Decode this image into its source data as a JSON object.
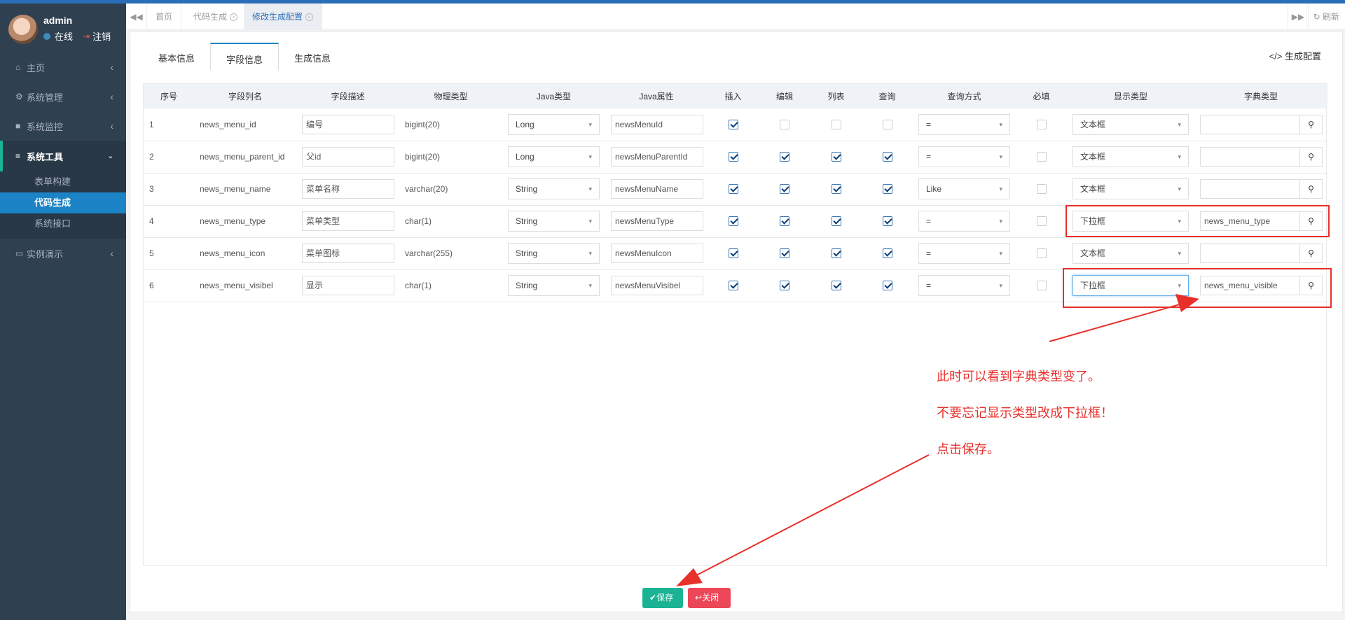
{
  "user": {
    "name": "admin",
    "status": "在线",
    "logout": "注销"
  },
  "sidebar": {
    "items": [
      {
        "label": "主页",
        "icon": "home-icon"
      },
      {
        "label": "系统管理",
        "icon": "gear-icon"
      },
      {
        "label": "系统监控",
        "icon": "video-icon"
      },
      {
        "label": "系统工具",
        "icon": "bars-icon"
      },
      {
        "label": "实例演示",
        "icon": "desktop-icon"
      }
    ],
    "submenu": [
      "表单构建",
      "代码生成",
      "系统接口"
    ]
  },
  "tabs": {
    "items": [
      "首页",
      "代码生成",
      "修改生成配置"
    ],
    "refresh": "刷新"
  },
  "inner_tabs": [
    "基本信息",
    "字段信息",
    "生成信息"
  ],
  "gen_config_link": "生成配置",
  "table": {
    "headers": [
      "序号",
      "字段列名",
      "字段描述",
      "物理类型",
      "Java类型",
      "Java属性",
      "插入",
      "编辑",
      "列表",
      "查询",
      "查询方式",
      "必填",
      "显示类型",
      "字典类型"
    ],
    "rows": [
      {
        "no": "1",
        "column": "news_menu_id",
        "desc": "编号",
        "phys": "bigint(20)",
        "jtype": "Long",
        "jattr": "newsMenuId",
        "insert": true,
        "edit": false,
        "list": false,
        "query": false,
        "qmode": "=",
        "required": false,
        "display": "文本框",
        "dict": ""
      },
      {
        "no": "2",
        "column": "news_menu_parent_id",
        "desc": "父id",
        "phys": "bigint(20)",
        "jtype": "Long",
        "jattr": "newsMenuParentId",
        "insert": true,
        "edit": true,
        "list": true,
        "query": true,
        "qmode": "=",
        "required": false,
        "display": "文本框",
        "dict": ""
      },
      {
        "no": "3",
        "column": "news_menu_name",
        "desc": "菜单名称",
        "phys": "varchar(20)",
        "jtype": "String",
        "jattr": "newsMenuName",
        "insert": true,
        "edit": true,
        "list": true,
        "query": true,
        "qmode": "Like",
        "required": false,
        "display": "文本框",
        "dict": ""
      },
      {
        "no": "4",
        "column": "news_menu_type",
        "desc": "菜单类型",
        "phys": "char(1)",
        "jtype": "String",
        "jattr": "newsMenuType",
        "insert": true,
        "edit": true,
        "list": true,
        "query": true,
        "qmode": "=",
        "required": false,
        "display": "下拉框",
        "dict": "news_menu_type"
      },
      {
        "no": "5",
        "column": "news_menu_icon",
        "desc": "菜单图标",
        "phys": "varchar(255)",
        "jtype": "String",
        "jattr": "newsMenuIcon",
        "insert": true,
        "edit": true,
        "list": true,
        "query": true,
        "qmode": "=",
        "required": false,
        "display": "文本框",
        "dict": ""
      },
      {
        "no": "6",
        "column": "news_menu_visibel",
        "desc": "显示",
        "phys": "char(1)",
        "jtype": "String",
        "jattr": "newsMenuVisibel",
        "insert": true,
        "edit": true,
        "list": true,
        "query": true,
        "qmode": "=",
        "required": false,
        "display": "下拉框",
        "dict": "news_menu_visible"
      }
    ]
  },
  "annotations": [
    "此时可以看到字典类型变了。",
    "不要忘记显示类型改成下拉框！",
    "点击保存。"
  ],
  "buttons": {
    "save": "保存",
    "close": "关闭"
  },
  "colors": {
    "sidebar": "#2f4050",
    "accent": "#1c84c6",
    "save": "#1ab394",
    "close": "#ec4758",
    "annotation": "#e8302b"
  }
}
